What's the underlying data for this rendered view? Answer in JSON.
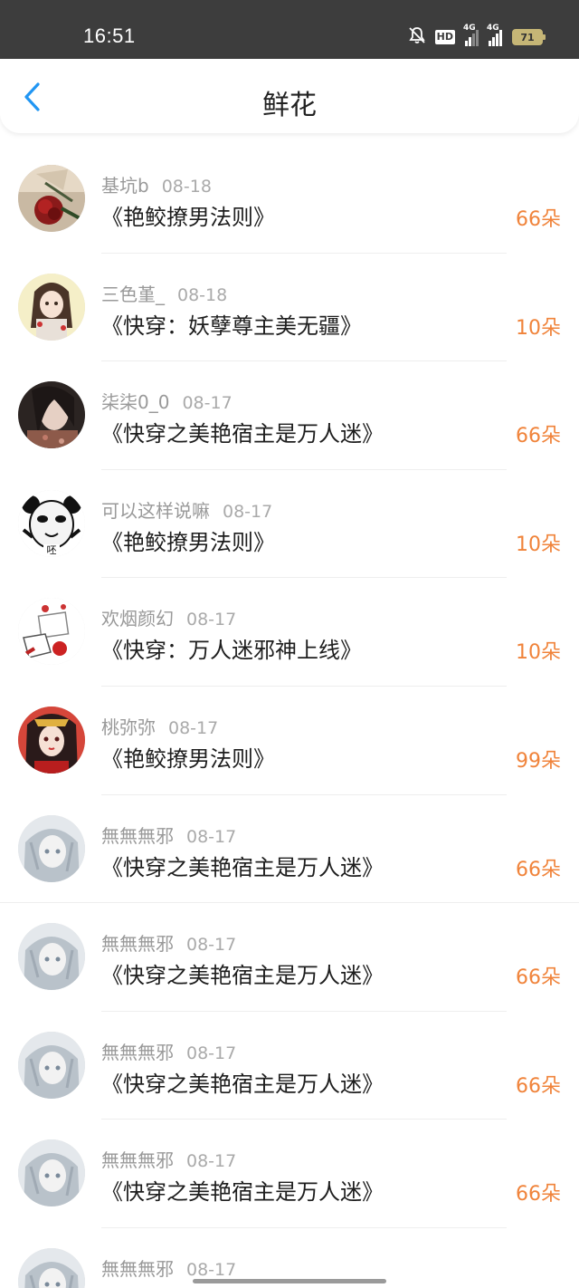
{
  "status": {
    "time": "16:51",
    "battery": "71",
    "hd": "HD",
    "net1": "4G",
    "net2": "4G"
  },
  "header": {
    "title": "鲜花"
  },
  "icons": {
    "back": "back-chevron-icon",
    "mute": "bell-off-icon"
  },
  "colors": {
    "accent_blue": "#2196f3",
    "count_orange": "#f0833a",
    "statusbar": "#3d3d3d"
  },
  "items": [
    {
      "user": "基坑b",
      "date": "08-18",
      "book": "《艳鲛撩男法则》",
      "count": "66朵",
      "avatar": "rose-avatar"
    },
    {
      "user": "三色堇_",
      "date": "08-18",
      "book": "《快穿：妖孽尊主美无疆》",
      "count": "10朵",
      "avatar": "anime-girl-avatar"
    },
    {
      "user": "柒柒0_0",
      "date": "08-17",
      "book": "《快穿之美艳宿主是万人迷》",
      "count": "66朵",
      "avatar": "girl-photo-avatar"
    },
    {
      "user": "可以这样说嘛",
      "date": "08-17",
      "book": "《艳鲛撩男法则》",
      "count": "10朵",
      "avatar": "panda-meme-avatar"
    },
    {
      "user": "欢烟颜幻",
      "date": "08-17",
      "book": "《快穿：万人迷邪神上线》",
      "count": "10朵",
      "avatar": "cartoon-avatar"
    },
    {
      "user": "桃弥弥",
      "date": "08-17",
      "book": "《艳鲛撩男法则》",
      "count": "99朵",
      "avatar": "red-anime-avatar"
    },
    {
      "user": "無無無邪",
      "date": "08-17",
      "book": "《快穿之美艳宿主是万人迷》",
      "count": "66朵",
      "avatar": "grey-anime-avatar"
    },
    {
      "user": "無無無邪",
      "date": "08-17",
      "book": "《快穿之美艳宿主是万人迷》",
      "count": "66朵",
      "avatar": "grey-anime-avatar"
    },
    {
      "user": "無無無邪",
      "date": "08-17",
      "book": "《快穿之美艳宿主是万人迷》",
      "count": "66朵",
      "avatar": "grey-anime-avatar"
    },
    {
      "user": "無無無邪",
      "date": "08-17",
      "book": "《快穿之美艳宿主是万人迷》",
      "count": "66朵",
      "avatar": "grey-anime-avatar"
    },
    {
      "user": "無無無邪",
      "date": "08-17",
      "book": "",
      "count": "",
      "avatar": "grey-anime-avatar"
    }
  ]
}
